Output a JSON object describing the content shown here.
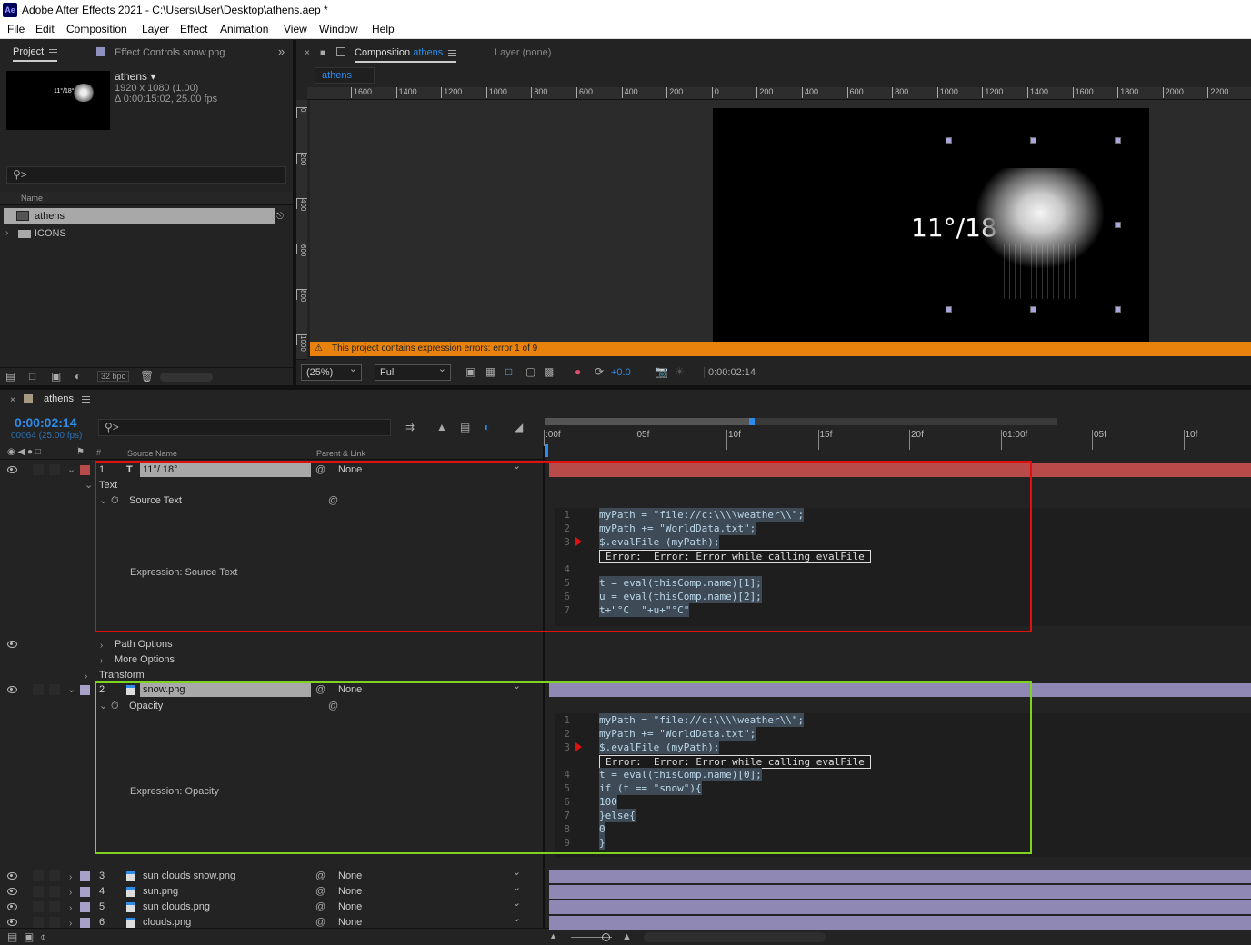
{
  "window": {
    "title": "Adobe After Effects 2021 - C:\\Users\\User\\Desktop\\athens.aep *",
    "logo": "Ae"
  },
  "menu": [
    "File",
    "Edit",
    "Composition",
    "Layer",
    "Effect",
    "Animation",
    "View",
    "Window",
    "Help"
  ],
  "project_panel": {
    "tab_project": "Project",
    "tab_effect_controls": "Effect Controls snow.png",
    "comp_name": "athens ▾",
    "comp_size": "1920 x 1080 (1.00)",
    "comp_duration": "Δ 0:00:15:02, 25.00 fps",
    "thumb_text": "11°/18°",
    "col_name": "Name",
    "items": [
      {
        "label": "athens",
        "type": "composition"
      },
      {
        "label": "ICONS",
        "type": "folder"
      }
    ],
    "bpc": "32 bpc"
  },
  "comp_panel": {
    "tab_label": "Composition",
    "tab_comp_name": "athens",
    "layer_tab": "Layer (none)",
    "breadcrumb": "athens",
    "h_ruler": [
      "1600",
      "1400",
      "1200",
      "1000",
      "800",
      "600",
      "400",
      "200",
      "0",
      "200",
      "400",
      "600",
      "800",
      "1000",
      "1200",
      "1400",
      "1600",
      "1800",
      "2000",
      "2200"
    ],
    "v_ruler": [
      "0",
      "200",
      "400",
      "600",
      "800",
      "1000"
    ],
    "overlay_text": "11°/18°",
    "error_banner": "This project contains expression errors: error 1 of 9",
    "zoom": "(25%)",
    "resolution": "Full",
    "exposure": "+0.0",
    "timecode": "0:00:02:14"
  },
  "timeline": {
    "tab": "athens",
    "timecode": "0:00:02:14",
    "frame_info": "00064 (25.00 fps)",
    "col_number": "#",
    "col_source": "Source Name",
    "col_parent": "Parent & Link",
    "ruler": [
      ":00f",
      "05f",
      "10f",
      "15f",
      "20f",
      "01:00f",
      "05f",
      "10f"
    ],
    "layers_top": [
      {
        "num": "1",
        "name": "11°/ 18°",
        "parent": "None",
        "type": "text",
        "color": "#b84a4a"
      },
      {
        "num": "2",
        "name": "snow.png",
        "parent": "None",
        "type": "footage",
        "color": "#a7a1c9"
      }
    ],
    "layer1_props": {
      "group": "Text",
      "prop": "Source Text",
      "expr_label": "Expression: Source Text",
      "path_options": "Path Options",
      "more_options": "More Options",
      "transform": "Transform"
    },
    "layer2_props": {
      "prop": "Opacity",
      "expr_label": "Expression: Opacity"
    },
    "expr1": {
      "lines": [
        {
          "n": "1",
          "t": "myPath = \"file://c:\\\\\\\\weather\\\\\";"
        },
        {
          "n": "2",
          "t": "myPath += \"WorldData.txt\";"
        },
        {
          "n": "3",
          "t": "$.evalFile (myPath);"
        },
        {
          "n": "4",
          "t": ""
        },
        {
          "n": "5",
          "t": "t = eval(thisComp.name)[1];"
        },
        {
          "n": "6",
          "t": "u = eval(thisComp.name)[2];"
        },
        {
          "n": "7",
          "t": "t+\"°C  \"+u+\"°C\""
        }
      ],
      "error": "Error:  Error: Error while calling evalFile"
    },
    "expr2": {
      "lines": [
        {
          "n": "1",
          "t": "myPath = \"file://c:\\\\\\\\weather\\\\\";"
        },
        {
          "n": "2",
          "t": "myPath += \"WorldData.txt\";"
        },
        {
          "n": "3",
          "t": "$.evalFile (myPath);"
        },
        {
          "n": "4",
          "t": "t = eval(thisComp.name)[0];"
        },
        {
          "n": "5",
          "t": "if (t == \"snow\"){"
        },
        {
          "n": "6",
          "t": "100"
        },
        {
          "n": "7",
          "t": "}else{"
        },
        {
          "n": "8",
          "t": "0"
        },
        {
          "n": "9",
          "t": "}"
        }
      ],
      "error": "Error:  Error: Error while calling evalFile"
    },
    "layers_bottom": [
      {
        "num": "3",
        "name": "sun clouds snow.png",
        "parent": "None"
      },
      {
        "num": "4",
        "name": "sun.png",
        "parent": "None"
      },
      {
        "num": "5",
        "name": "sun clouds.png",
        "parent": "None"
      },
      {
        "num": "6",
        "name": "clouds.png",
        "parent": "None"
      }
    ]
  },
  "colors": {
    "accent_blue": "#2d8ceb",
    "error_orange": "#e8820c",
    "red_box": "#e01010",
    "green_box": "#7ed321"
  }
}
